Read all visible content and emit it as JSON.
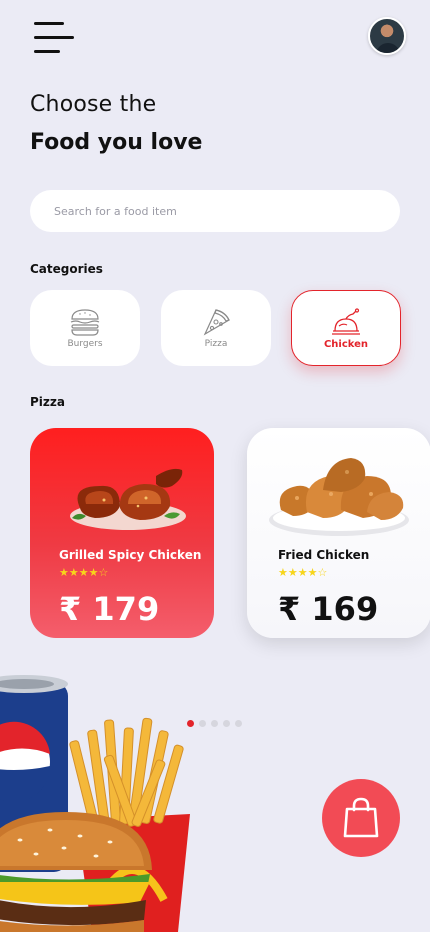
{
  "header": {
    "menu_icon": "hamburger-menu-icon",
    "avatar_icon": "user-avatar"
  },
  "hero": {
    "line1": "Choose the",
    "line2": "Food you love"
  },
  "search": {
    "placeholder": "Search for a food item",
    "value": ""
  },
  "categories": {
    "title": "Categories",
    "items": [
      {
        "label": "Burgers",
        "icon": "burger-icon",
        "selected": false
      },
      {
        "label": "Pizza",
        "icon": "pizza-icon",
        "selected": false
      },
      {
        "label": "Chicken",
        "icon": "chicken-icon",
        "selected": true
      }
    ]
  },
  "section": {
    "title": "Pizza"
  },
  "cards": [
    {
      "name": "Grilled Spicy Chicken",
      "rating": 4,
      "stars": "★★★★☆",
      "price": "₹ 179",
      "image": "grilled-chicken-image"
    },
    {
      "name": "Fried Chicken",
      "rating": 4,
      "stars": "★★★★☆",
      "price": "₹ 169",
      "image": "fried-chicken-image"
    }
  ],
  "pagination": {
    "total": 5,
    "active": 1
  },
  "cart_icon": "shopping-bag-icon",
  "colors": {
    "accent": "#e3242b",
    "background": "#ebebf5",
    "star": "#f7d51a",
    "cart": "#f24b55"
  }
}
